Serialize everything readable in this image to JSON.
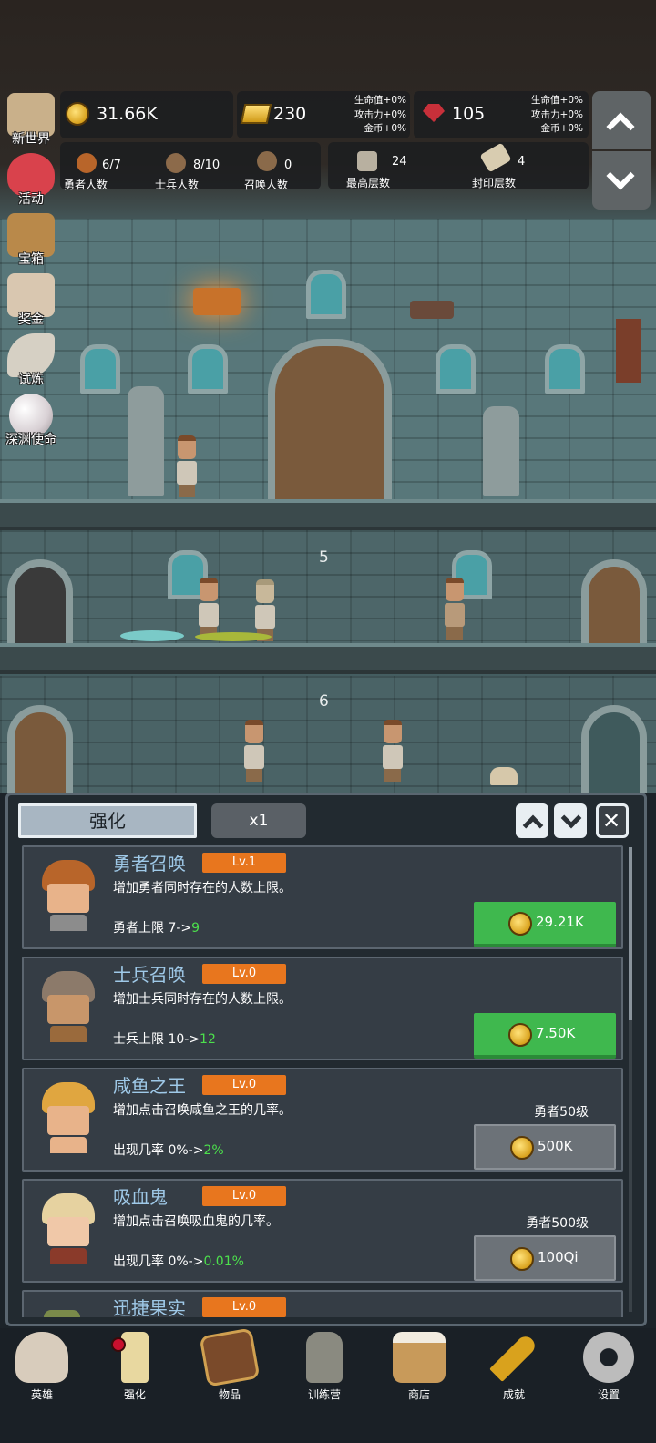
{
  "side_menu": [
    {
      "label": "新世界",
      "icon": "map-scroll-icon",
      "color": "#c9b08a"
    },
    {
      "label": "活动",
      "icon": "heart-icon",
      "color": "#d9424c"
    },
    {
      "label": "宝箱",
      "icon": "treasure-chest-icon",
      "color": "#b9894a"
    },
    {
      "label": "奖金",
      "icon": "envelope-icon",
      "color": "#d9c7b0"
    },
    {
      "label": "试炼",
      "icon": "quill-icon",
      "color": "#d6d0c4"
    },
    {
      "label": "深渊使命",
      "icon": "pearl-orb-icon",
      "color": "#e6dfe0"
    }
  ],
  "resources": {
    "gold": {
      "value": "31.66K",
      "icon": "gold-coin-icon"
    },
    "ingot": {
      "value": "230",
      "icon": "gold-ingot-icon",
      "bonus": [
        "生命值+0%",
        "攻击力+0%",
        "金币+0%"
      ]
    },
    "gem": {
      "value": "105",
      "icon": "ruby-gem-icon",
      "bonus": [
        "生命值+0%",
        "攻击力+0%",
        "金币+0%"
      ]
    }
  },
  "counts": [
    {
      "value": "6/7",
      "label": "勇者人数",
      "icon": "hero-icon"
    },
    {
      "value": "8/10",
      "label": "士兵人数",
      "icon": "soldier-icon"
    },
    {
      "value": "0",
      "label": "召唤人数",
      "icon": "summon-icon"
    },
    {
      "value": "24",
      "label": "最高层数",
      "icon": "stone-tablet-icon"
    },
    {
      "value": "4",
      "label": "封印层数",
      "icon": "sealed-scroll-icon"
    }
  ],
  "floors": [
    "5",
    "6"
  ],
  "panel": {
    "tab_label": "强化",
    "multiplier": "x1"
  },
  "upgrades": [
    {
      "title": "勇者召唤",
      "level": "Lv.1",
      "desc": "增加勇者同时存在的人数上限。",
      "stat_prefix": "勇者上限 7->",
      "stat_new": "9",
      "requirement": "",
      "price": "29.21K",
      "available": true,
      "hair": "#b8652a",
      "torso": "#8c8c8c"
    },
    {
      "title": "士兵召唤",
      "level": "Lv.0",
      "desc": "增加士兵同时存在的人数上限。",
      "stat_prefix": "士兵上限 10->",
      "stat_new": "12",
      "requirement": "",
      "price": "7.50K",
      "available": true,
      "hair": "#8c7a6a",
      "torso": "#9a6a3c"
    },
    {
      "title": "咸鱼之王",
      "level": "Lv.0",
      "desc": "增加点击召唤咸鱼之王的几率。",
      "stat_prefix": "出现几率 0%->",
      "stat_new": "2%",
      "requirement": "勇者50级",
      "price": "500K",
      "available": false,
      "hair": "#e0a640",
      "torso": "#e8b38a"
    },
    {
      "title": "吸血鬼",
      "level": "Lv.0",
      "desc": "增加点击召唤吸血鬼的几率。",
      "stat_prefix": "出现几率 0%->",
      "stat_new": "0.01%",
      "requirement": "勇者500级",
      "price": "100Qi",
      "available": false,
      "hair": "#e6d2a0",
      "torso": "#8a3a2a"
    },
    {
      "title": "迅捷果实",
      "level": "Lv.0",
      "desc": "",
      "stat_prefix": "",
      "stat_new": "",
      "requirement": "",
      "price": "",
      "available": false,
      "hair": "#7a8a4a",
      "torso": "#5a6a3a"
    }
  ],
  "bottom_nav": [
    {
      "label": "英雄",
      "icon": "skull-icon",
      "color": "#d8ccbc"
    },
    {
      "label": "强化",
      "icon": "candle-icon",
      "color": "#e8d8a0"
    },
    {
      "label": "物品",
      "icon": "spellbook-icon",
      "color": "#7a4a2a"
    },
    {
      "label": "训练营",
      "icon": "lantern-icon",
      "color": "#8a8a80"
    },
    {
      "label": "商店",
      "icon": "beer-mug-icon",
      "color": "#c89a5a"
    },
    {
      "label": "成就",
      "icon": "golden-key-icon",
      "color": "#d9a21d"
    },
    {
      "label": "设置",
      "icon": "gear-icon",
      "color": "#bcbcbc"
    }
  ],
  "colors": {
    "accent_orange": "#e8761e",
    "buy_green": "#3fb84e",
    "title_blue": "#9fc9e8",
    "new_value_green": "#4ce04c"
  }
}
